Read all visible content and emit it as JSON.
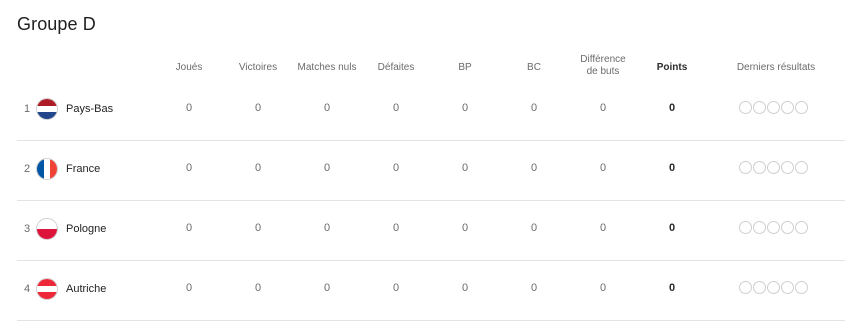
{
  "group_title": "Groupe D",
  "columns": {
    "played": "Joués",
    "wins": "Victoires",
    "draws": "Matches nuls",
    "losses": "Défaites",
    "gf": "BP",
    "ga": "BC",
    "diff_line1": "Différence",
    "diff_line2": "de buts",
    "points": "Points",
    "recent": "Derniers résultats"
  },
  "rows": [
    {
      "rank": "1",
      "team": "Pays-Bas",
      "flag": "netherlands-flag-icon",
      "played": "0",
      "wins": "0",
      "draws": "0",
      "losses": "0",
      "gf": "0",
      "ga": "0",
      "diff": "0",
      "points": "0"
    },
    {
      "rank": "2",
      "team": "France",
      "flag": "france-flag-icon",
      "played": "0",
      "wins": "0",
      "draws": "0",
      "losses": "0",
      "gf": "0",
      "ga": "0",
      "diff": "0",
      "points": "0"
    },
    {
      "rank": "3",
      "team": "Pologne",
      "flag": "poland-flag-icon",
      "played": "0",
      "wins": "0",
      "draws": "0",
      "losses": "0",
      "gf": "0",
      "ga": "0",
      "diff": "0",
      "points": "0"
    },
    {
      "rank": "4",
      "team": "Autriche",
      "flag": "austria-flag-icon",
      "played": "0",
      "wins": "0",
      "draws": "0",
      "losses": "0",
      "gf": "0",
      "ga": "0",
      "diff": "0",
      "points": "0"
    }
  ],
  "colors": {
    "nl_red": "#ae1c28",
    "nl_blue": "#21468b",
    "fr_blue": "#0055a4",
    "fr_red": "#ef4135",
    "pl_red": "#dc143c",
    "at_red": "#ed2939"
  }
}
